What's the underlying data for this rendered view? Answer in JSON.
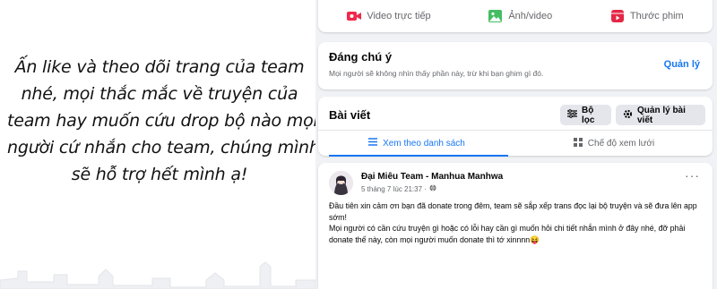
{
  "banner": {
    "lines": [
      "Ấn like và theo dõi trang của team",
      "nhé, mọi thắc mắc về truyện của",
      "team hay muốn cứu drop bộ nào mọi",
      "người cứ nhắn cho team, chúng mình",
      "sẽ hỗ trợ hết mình ạ!"
    ]
  },
  "actions": [
    {
      "label": "Video trực tiếp",
      "icon": "live-video-icon",
      "color": "#f02849"
    },
    {
      "label": "Ảnh/video",
      "icon": "photo-video-icon",
      "color": "#45bd62"
    },
    {
      "label": "Thước phim",
      "icon": "reels-icon",
      "color": "#e42645"
    }
  ],
  "notice": {
    "title": "Đáng chú ý",
    "subtitle": "Mọi người sẽ không nhìn thấy phần này, trừ khi bạn ghim gì đó.",
    "manage_label": "Quản lý"
  },
  "posts_section": {
    "title": "Bài viết",
    "filter_label": "Bộ lọc",
    "manage_label": "Quản lý bài viết",
    "tabs": [
      {
        "label": "Xem theo danh sách",
        "active": true
      },
      {
        "label": "Chế độ xem lưới",
        "active": false
      }
    ]
  },
  "post": {
    "author": "Đại Miêu Team - Manhua Manhwa",
    "time": "5 tháng 7 lúc 21:37 ·",
    "body": [
      "Đầu tiên xin cảm ơn bạn đã donate trong đêm, team sẽ sắp xếp trans đọc lại bộ truyện và sẽ đưa lên app sớm!",
      "Mọi người có cần cứu truyện gì hoặc có lỗi hay cần gì muốn hỏi chi tiết nhắn mình ở đây nhé, đỡ phải donate thế này, còn mọi người muốn donate thì tớ xinnnn😝"
    ],
    "more": "···"
  },
  "colors": {
    "accent": "#1877f2",
    "muted": "#65676b",
    "bg": "#f0f2f5"
  }
}
